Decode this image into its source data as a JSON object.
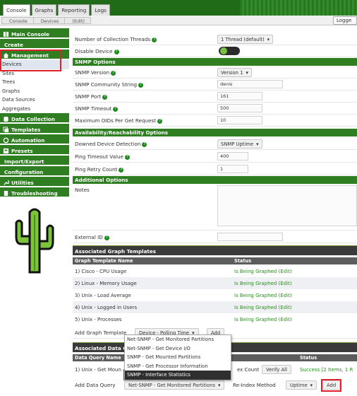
{
  "tabs": [
    "Console",
    "Graphs",
    "Reporting",
    "Logs"
  ],
  "breadcrumbs": [
    "Console",
    "Devices",
    "(Edit)"
  ],
  "logout_label": "Logge",
  "sidebar": {
    "main_console": "Main Console",
    "create": "Create",
    "management": "Management",
    "management_items": [
      "Devices",
      "Sites",
      "Trees",
      "Graphs",
      "Data Sources",
      "Aggregates"
    ],
    "data_collection": "Data Collection",
    "templates": "Templates",
    "automation": "Automation",
    "presets": "Presets",
    "import_export": "Import/Export",
    "configuration": "Configuration",
    "utilities": "Utilities",
    "troubleshooting": "Troubleshooting"
  },
  "form": {
    "collection_threads_label": "Number of Collection Threads",
    "collection_threads_value": "1 Thread (default)",
    "disable_device_label": "Disable Device",
    "snmp_options": "SNMP Options",
    "snmp_version_label": "SNMP Version",
    "snmp_version_value": "Version 1",
    "community_label": "SNMP Community String",
    "community_value": "denis",
    "snmp_port_label": "SNMP Port",
    "snmp_port_value": "161",
    "snmp_timeout_label": "SNMP Timeout",
    "snmp_timeout_value": "500",
    "max_oids_label": "Maximum OIDs Per Get Request",
    "max_oids_value": "10",
    "availability_section": "Availability/Reachability Options",
    "downed_label": "Downed Device Detection",
    "downed_value": "SNMP Uptime",
    "ping_timeout_label": "Ping Timeout Value",
    "ping_timeout_value": "400",
    "ping_retry_label": "Ping Retry Count",
    "ping_retry_value": "1",
    "additional_section": "Additional Options",
    "notes_label": "Notes",
    "external_id_label": "External ID"
  },
  "graph_templates": {
    "header": "Associated Graph Templates",
    "col_name": "Graph Template Name",
    "col_status": "Status",
    "rows": [
      {
        "name": "1) Cisco - CPU Usage",
        "status": "Is Being Graphed (Edit)"
      },
      {
        "name": "2) Linux - Memory Usage",
        "status": "Is Being Graphed (Edit)"
      },
      {
        "name": "3) Unix - Load Average",
        "status": "Is Being Graphed (Edit)"
      },
      {
        "name": "4) Unix - Logged in Users",
        "status": "Is Being Graphed (Edit)"
      },
      {
        "name": "5) Unix - Processes",
        "status": "Is Being Graphed (Edit)"
      }
    ],
    "add_label": "Add Graph Template",
    "add_select": "Device - Polling Time",
    "add_button": "Add"
  },
  "data_queries": {
    "header": "Associated Data Qu",
    "col_name": "Data Query Name",
    "col_status": "Status",
    "row_name": "1) Unix - Get Moun",
    "row_index_count": "ex Count",
    "row_verify": "Verify All",
    "row_status": "Success [2 Items, 1 R",
    "add_label": "Add Data Query",
    "add_select": "Net-SNMP - Get Monitored Partitions",
    "reindex_label": "Re-Index Method",
    "reindex_value": "Uptime",
    "add_button": "Add"
  },
  "dropdown_options": [
    "Net-SNMP - Get Monitored Partitions",
    "Net-SNMP - Get Device I/O",
    "SNMP - Get Mounted Partitions",
    "SNMP - Get Processor Information",
    "SNMP - Interface Statistics"
  ],
  "colors": {
    "accent_green": "#2f7f22",
    "highlight_red": "#e0202a",
    "status_green": "#2a8f1e"
  }
}
